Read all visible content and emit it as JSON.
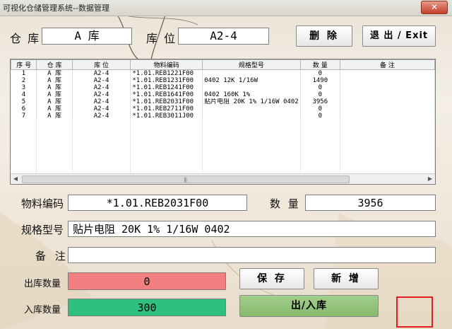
{
  "window": {
    "title": "可视化仓储管理系统--数据管理",
    "close_glyph": "✕"
  },
  "header": {
    "warehouse_label": "仓 库",
    "warehouse_value": "A 库",
    "location_label": "库 位",
    "location_value": "A2-4",
    "delete_button": "删 除",
    "exit_button": "退 出 / Exit"
  },
  "grid": {
    "columns": [
      "序 号",
      "仓 库",
      "库 位",
      "物料编码",
      "规格型号",
      "数 量",
      "备 注"
    ],
    "rows": [
      [
        "1",
        "A 库",
        "A2-4",
        "*1.01.REB1221F00",
        "",
        "0",
        ""
      ],
      [
        "2",
        "A 库",
        "A2-4",
        "*1.01.REB1231F00",
        "0402 12K 1/16W",
        "1490",
        ""
      ],
      [
        "3",
        "A 库",
        "A2-4",
        "*1.01.REB1241F00",
        "",
        "0",
        ""
      ],
      [
        "4",
        "A 库",
        "A2-4",
        "*1.01.REB1641F00",
        "0402 160K 1%",
        "0",
        ""
      ],
      [
        "5",
        "A 库",
        "A2-4",
        "*1.01.REB2031F00",
        "贴片电阻 20K 1% 1/16W 0402",
        "3956",
        ""
      ],
      [
        "6",
        "A 库",
        "A2-4",
        "*1.01.REB2711F00",
        "",
        "0",
        ""
      ],
      [
        "7",
        "A 库",
        "A2-4",
        "*1.01.REB3011J00",
        "",
        "0",
        ""
      ]
    ]
  },
  "form": {
    "material_label": "物料编码",
    "material_value": "*1.01.REB2031F00",
    "qty_label": "数 量",
    "qty_value": "3956",
    "spec_label": "规格型号",
    "spec_value": "贴片电阻 20K 1% 1/16W 0402",
    "note_label": "备 注",
    "note_value": "",
    "out_label": "出库数量",
    "out_value": "0",
    "in_label": "入库数量",
    "in_value": "300",
    "save_button": "保 存",
    "new_button": "新 增",
    "inout_button": "出/入库"
  },
  "colors": {
    "out_bg": "#f28080",
    "in_bg": "#2ec07e",
    "inout_bg": "#8fc078",
    "accent_red": "#e02020"
  }
}
